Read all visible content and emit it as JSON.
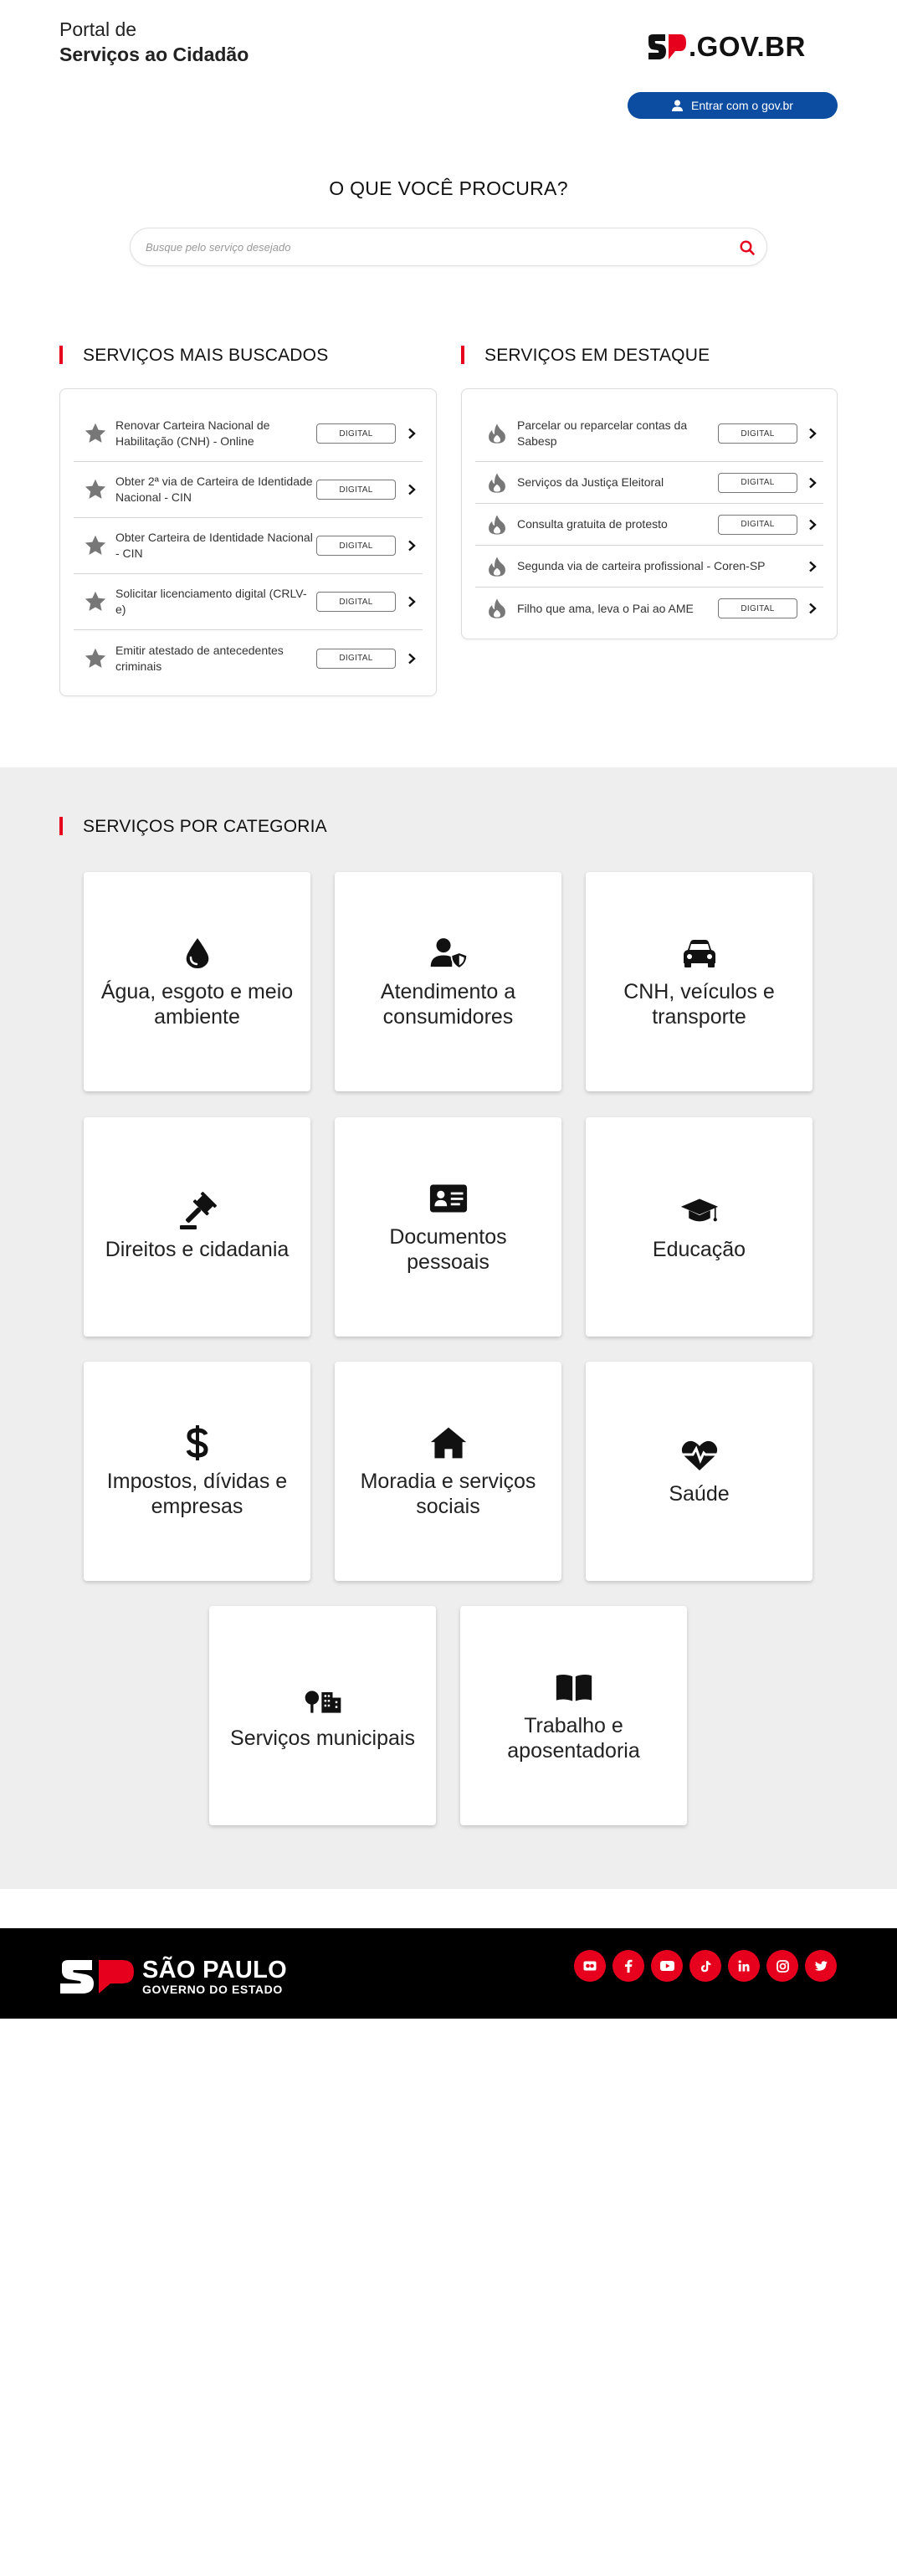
{
  "header": {
    "portal_line1": "Portal de",
    "portal_line2": "Serviços ao Cidadão",
    "brand_text": ".GOV.BR",
    "login_label": "Entrar com o gov.br"
  },
  "search": {
    "title": "O QUE VOCÊ PROCURA?",
    "placeholder": "Busque pelo serviço desejado"
  },
  "most_searched": {
    "title": "SERVIÇOS MAIS BUSCADOS",
    "items": [
      {
        "label": "Renovar Carteira Nacional de Habilitação (CNH) - Online",
        "badge": "DIGITAL",
        "icon": "star-icon"
      },
      {
        "label": "Obter 2ª via de Carteira de Identidade Nacional - CIN",
        "badge": "DIGITAL",
        "icon": "star-icon"
      },
      {
        "label": "Obter Carteira de Identidade Nacional - CIN",
        "badge": "DIGITAL",
        "icon": "star-icon"
      },
      {
        "label": "Solicitar licenciamento digital (CRLV-e)",
        "badge": "DIGITAL",
        "icon": "star-icon"
      },
      {
        "label": "Emitir atestado de antecedentes criminais",
        "badge": "DIGITAL",
        "icon": "star-icon"
      }
    ]
  },
  "featured": {
    "title": "SERVIÇOS EM DESTAQUE",
    "items": [
      {
        "label": "Parcelar ou reparcelar contas da Sabesp",
        "badge": "DIGITAL",
        "icon": "flame-icon"
      },
      {
        "label": "Serviços da Justiça Eleitoral",
        "badge": "DIGITAL",
        "icon": "flame-icon"
      },
      {
        "label": "Consulta gratuita de protesto",
        "badge": "DIGITAL",
        "icon": "flame-icon"
      },
      {
        "label": "Segunda via de carteira profissional - Coren-SP",
        "badge": "",
        "icon": "flame-icon"
      },
      {
        "label": "Filho que ama, leva o Pai ao AME",
        "badge": "DIGITAL",
        "icon": "flame-icon"
      }
    ]
  },
  "categories": {
    "title": "SERVIÇOS POR CATEGORIA",
    "items": [
      {
        "label": "Água, esgoto e meio ambiente",
        "icon": "water-drop-icon"
      },
      {
        "label": "Atendimento a consumidores",
        "icon": "user-shield-icon"
      },
      {
        "label": "CNH, veículos e transporte",
        "icon": "car-icon"
      },
      {
        "label": "Direitos e cidadania",
        "icon": "gavel-icon"
      },
      {
        "label": "Documentos pessoais",
        "icon": "id-card-icon"
      },
      {
        "label": "Educação",
        "icon": "graduation-cap-icon"
      },
      {
        "label": "Impostos, dívidas e empresas",
        "icon": "dollar-icon"
      },
      {
        "label": "Moradia e serviços sociais",
        "icon": "house-icon"
      },
      {
        "label": "Saúde",
        "icon": "heart-pulse-icon"
      },
      {
        "label": "Serviços municipais",
        "icon": "city-icon"
      },
      {
        "label": "Trabalho e aposentadoria",
        "icon": "book-icon"
      }
    ]
  },
  "footer": {
    "logo_line1": "SÃO PAULO",
    "logo_line2": "GOVERNO DO ESTADO",
    "social": [
      "flickr-icon",
      "facebook-icon",
      "youtube-icon",
      "tiktok-icon",
      "linkedin-icon",
      "instagram-icon",
      "twitter-icon"
    ]
  },
  "colors": {
    "accent_red": "#e6001e",
    "button_blue": "#0c4da2",
    "category_bg": "#eeeeee",
    "footer_bg": "#000000"
  }
}
